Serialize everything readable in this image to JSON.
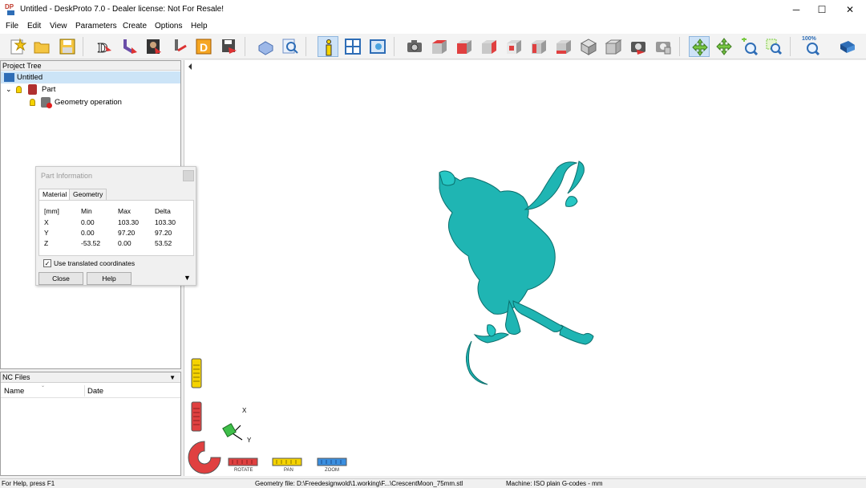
{
  "window": {
    "title": "Untitled - DeskProto 7.0 - Dealer license: Not For Resale!",
    "logo_text": "DP",
    "controls": [
      "─",
      "☐",
      "✕"
    ]
  },
  "menu": [
    "File",
    "Edit",
    "View",
    "Parameters",
    "Create",
    "Options",
    "Help"
  ],
  "toolbar": {
    "icons": [
      "new-icon",
      "open-icon",
      "save-icon",
      "wizard-icon",
      "wizard2-icon",
      "wizard3-icon",
      "wizard4-icon",
      "drawing-icon",
      "export-icon",
      "material-icon",
      "zoom-doc-icon",
      "info-icon",
      "layout-icon",
      "view-icon",
      "camera-icon",
      "view-top-icon",
      "view-front-icon",
      "view-right-icon",
      "view-back-icon",
      "view-left-icon",
      "view-bottom-icon",
      "view-iso-icon",
      "view-iso2-icon",
      "render-icon",
      "render2-icon",
      "rotate-icon",
      "pan-icon",
      "zoom-in-icon",
      "zoom-window-icon",
      "zoom-100-icon",
      "book-icon"
    ],
    "zoom_label": "100%"
  },
  "project_tree": {
    "header": "Project Tree",
    "items": [
      "Untitled",
      "Part",
      "Geometry operation"
    ]
  },
  "nc_files": {
    "header": "NC Files",
    "columns": [
      "Name",
      "Date"
    ]
  },
  "part_info": {
    "title": "Part Information",
    "tabs": [
      "Material",
      "Geometry"
    ],
    "headers": [
      "[mm]",
      "Min",
      "Max",
      "Delta"
    ],
    "rows": [
      [
        "X",
        "0.00",
        "103.30",
        "103.30"
      ],
      [
        "Y",
        "0.00",
        "97.20",
        "97.20"
      ],
      [
        "Z",
        "-53.52",
        "0.00",
        "53.52"
      ]
    ],
    "checkbox_label": "Use translated coordinates",
    "checkbox_checked": true,
    "close_label": "Close",
    "help_label": "Help"
  },
  "viewport": {
    "mode_labels": [
      "ROTATE",
      "PAN",
      "ZOOM"
    ],
    "axis_labels": [
      "X",
      "Y"
    ],
    "model_color": "#1fb5b3"
  },
  "status": {
    "help": "For Help, press F1",
    "geometry": "Geometry file: D:\\Freedesignwold\\1.working\\F...\\CrescentMoon_75mm.stl",
    "machine": "Machine: ISO plain G-codes - mm"
  }
}
